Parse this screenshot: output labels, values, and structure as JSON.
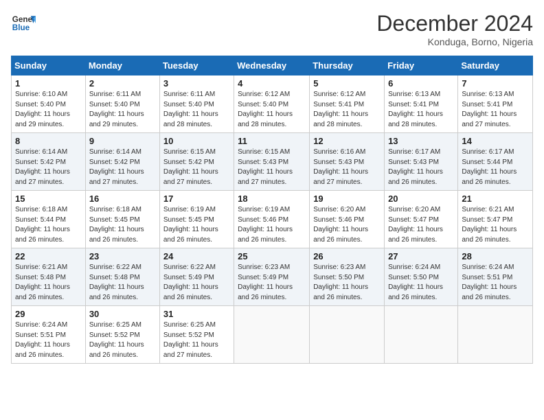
{
  "header": {
    "logo_line1": "General",
    "logo_line2": "Blue",
    "month_year": "December 2024",
    "location": "Konduga, Borno, Nigeria"
  },
  "days_of_week": [
    "Sunday",
    "Monday",
    "Tuesday",
    "Wednesday",
    "Thursday",
    "Friday",
    "Saturday"
  ],
  "weeks": [
    [
      {
        "day": 1,
        "info": "Sunrise: 6:10 AM\nSunset: 5:40 PM\nDaylight: 11 hours\nand 29 minutes."
      },
      {
        "day": 2,
        "info": "Sunrise: 6:11 AM\nSunset: 5:40 PM\nDaylight: 11 hours\nand 29 minutes."
      },
      {
        "day": 3,
        "info": "Sunrise: 6:11 AM\nSunset: 5:40 PM\nDaylight: 11 hours\nand 28 minutes."
      },
      {
        "day": 4,
        "info": "Sunrise: 6:12 AM\nSunset: 5:40 PM\nDaylight: 11 hours\nand 28 minutes."
      },
      {
        "day": 5,
        "info": "Sunrise: 6:12 AM\nSunset: 5:41 PM\nDaylight: 11 hours\nand 28 minutes."
      },
      {
        "day": 6,
        "info": "Sunrise: 6:13 AM\nSunset: 5:41 PM\nDaylight: 11 hours\nand 28 minutes."
      },
      {
        "day": 7,
        "info": "Sunrise: 6:13 AM\nSunset: 5:41 PM\nDaylight: 11 hours\nand 27 minutes."
      }
    ],
    [
      {
        "day": 8,
        "info": "Sunrise: 6:14 AM\nSunset: 5:42 PM\nDaylight: 11 hours\nand 27 minutes."
      },
      {
        "day": 9,
        "info": "Sunrise: 6:14 AM\nSunset: 5:42 PM\nDaylight: 11 hours\nand 27 minutes."
      },
      {
        "day": 10,
        "info": "Sunrise: 6:15 AM\nSunset: 5:42 PM\nDaylight: 11 hours\nand 27 minutes."
      },
      {
        "day": 11,
        "info": "Sunrise: 6:15 AM\nSunset: 5:43 PM\nDaylight: 11 hours\nand 27 minutes."
      },
      {
        "day": 12,
        "info": "Sunrise: 6:16 AM\nSunset: 5:43 PM\nDaylight: 11 hours\nand 27 minutes."
      },
      {
        "day": 13,
        "info": "Sunrise: 6:17 AM\nSunset: 5:43 PM\nDaylight: 11 hours\nand 26 minutes."
      },
      {
        "day": 14,
        "info": "Sunrise: 6:17 AM\nSunset: 5:44 PM\nDaylight: 11 hours\nand 26 minutes."
      }
    ],
    [
      {
        "day": 15,
        "info": "Sunrise: 6:18 AM\nSunset: 5:44 PM\nDaylight: 11 hours\nand 26 minutes."
      },
      {
        "day": 16,
        "info": "Sunrise: 6:18 AM\nSunset: 5:45 PM\nDaylight: 11 hours\nand 26 minutes."
      },
      {
        "day": 17,
        "info": "Sunrise: 6:19 AM\nSunset: 5:45 PM\nDaylight: 11 hours\nand 26 minutes."
      },
      {
        "day": 18,
        "info": "Sunrise: 6:19 AM\nSunset: 5:46 PM\nDaylight: 11 hours\nand 26 minutes."
      },
      {
        "day": 19,
        "info": "Sunrise: 6:20 AM\nSunset: 5:46 PM\nDaylight: 11 hours\nand 26 minutes."
      },
      {
        "day": 20,
        "info": "Sunrise: 6:20 AM\nSunset: 5:47 PM\nDaylight: 11 hours\nand 26 minutes."
      },
      {
        "day": 21,
        "info": "Sunrise: 6:21 AM\nSunset: 5:47 PM\nDaylight: 11 hours\nand 26 minutes."
      }
    ],
    [
      {
        "day": 22,
        "info": "Sunrise: 6:21 AM\nSunset: 5:48 PM\nDaylight: 11 hours\nand 26 minutes."
      },
      {
        "day": 23,
        "info": "Sunrise: 6:22 AM\nSunset: 5:48 PM\nDaylight: 11 hours\nand 26 minutes."
      },
      {
        "day": 24,
        "info": "Sunrise: 6:22 AM\nSunset: 5:49 PM\nDaylight: 11 hours\nand 26 minutes."
      },
      {
        "day": 25,
        "info": "Sunrise: 6:23 AM\nSunset: 5:49 PM\nDaylight: 11 hours\nand 26 minutes."
      },
      {
        "day": 26,
        "info": "Sunrise: 6:23 AM\nSunset: 5:50 PM\nDaylight: 11 hours\nand 26 minutes."
      },
      {
        "day": 27,
        "info": "Sunrise: 6:24 AM\nSunset: 5:50 PM\nDaylight: 11 hours\nand 26 minutes."
      },
      {
        "day": 28,
        "info": "Sunrise: 6:24 AM\nSunset: 5:51 PM\nDaylight: 11 hours\nand 26 minutes."
      }
    ],
    [
      {
        "day": 29,
        "info": "Sunrise: 6:24 AM\nSunset: 5:51 PM\nDaylight: 11 hours\nand 26 minutes."
      },
      {
        "day": 30,
        "info": "Sunrise: 6:25 AM\nSunset: 5:52 PM\nDaylight: 11 hours\nand 26 minutes."
      },
      {
        "day": 31,
        "info": "Sunrise: 6:25 AM\nSunset: 5:52 PM\nDaylight: 11 hours\nand 27 minutes."
      },
      {
        "day": null,
        "info": ""
      },
      {
        "day": null,
        "info": ""
      },
      {
        "day": null,
        "info": ""
      },
      {
        "day": null,
        "info": ""
      }
    ]
  ]
}
